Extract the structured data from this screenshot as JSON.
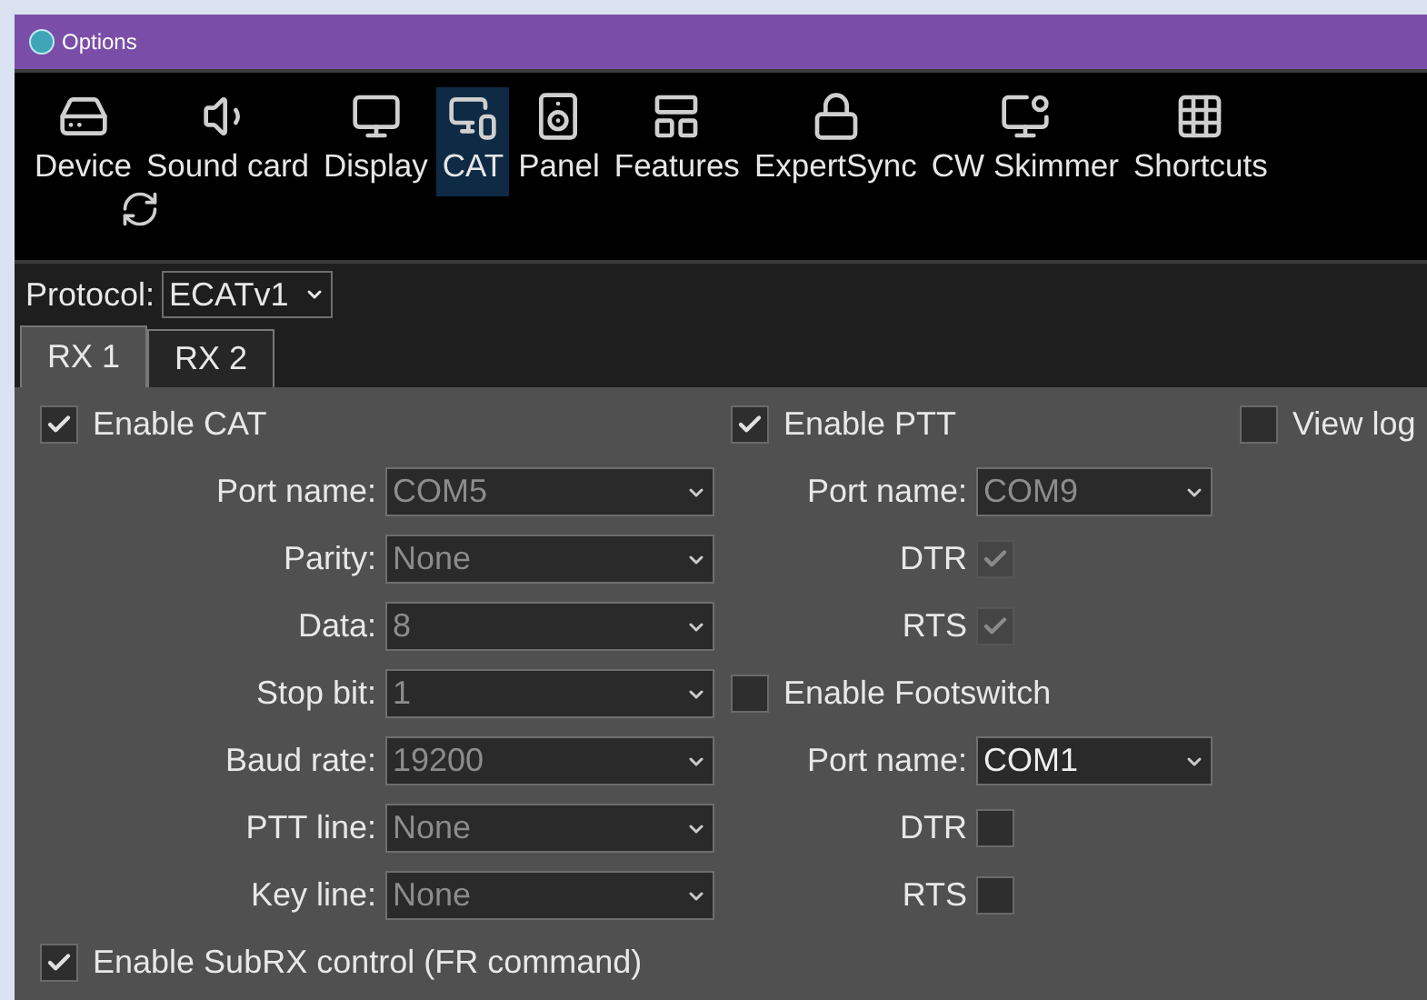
{
  "window": {
    "title": "Options"
  },
  "toolbar": [
    {
      "label": "Device",
      "selected": false
    },
    {
      "label": "Sound card",
      "selected": false
    },
    {
      "label": "Display",
      "selected": false
    },
    {
      "label": "CAT",
      "selected": true
    },
    {
      "label": "Panel",
      "selected": false
    },
    {
      "label": "Features",
      "selected": false
    },
    {
      "label": "ExpertSync",
      "selected": false
    },
    {
      "label": "CW Skimmer",
      "selected": false
    },
    {
      "label": "Shortcuts",
      "selected": false
    }
  ],
  "protocol": {
    "label": "Protocol:",
    "value": "ECATv1"
  },
  "tabs": [
    {
      "label": "RX 1",
      "selected": true
    },
    {
      "label": "RX 2",
      "selected": false
    }
  ],
  "cat": {
    "checkbox": {
      "label": "Enable CAT",
      "checked": true
    },
    "fields": [
      {
        "label": "Port name:",
        "value": "COM5",
        "disabled": true
      },
      {
        "label": "Parity:",
        "value": "None",
        "disabled": true
      },
      {
        "label": "Data:",
        "value": "8",
        "disabled": true
      },
      {
        "label": "Stop bit:",
        "value": "1",
        "disabled": true
      },
      {
        "label": "Baud rate:",
        "value": "19200",
        "disabled": true
      },
      {
        "label": "PTT line:",
        "value": "None",
        "disabled": true
      },
      {
        "label": "Key line:",
        "value": "None",
        "disabled": true
      }
    ]
  },
  "subrx": {
    "label": "Enable SubRX control (FR command)",
    "checked": true
  },
  "ptt": {
    "checkbox": {
      "label": "Enable PTT",
      "checked": true
    },
    "port": {
      "label": "Port name:",
      "value": "COM9",
      "disabled": true
    },
    "lines": [
      {
        "label": "DTR",
        "checked": true,
        "disabled": true
      },
      {
        "label": "RTS",
        "checked": true,
        "disabled": true
      }
    ]
  },
  "footswitch": {
    "checkbox": {
      "label": "Enable Footswitch",
      "checked": false
    },
    "port": {
      "label": "Port name:",
      "value": "COM1",
      "disabled": false
    },
    "lines": [
      {
        "label": "DTR",
        "checked": false,
        "disabled": false
      },
      {
        "label": "RTS",
        "checked": false,
        "disabled": false
      }
    ]
  },
  "view_log": {
    "label": "View log",
    "checked": false
  }
}
